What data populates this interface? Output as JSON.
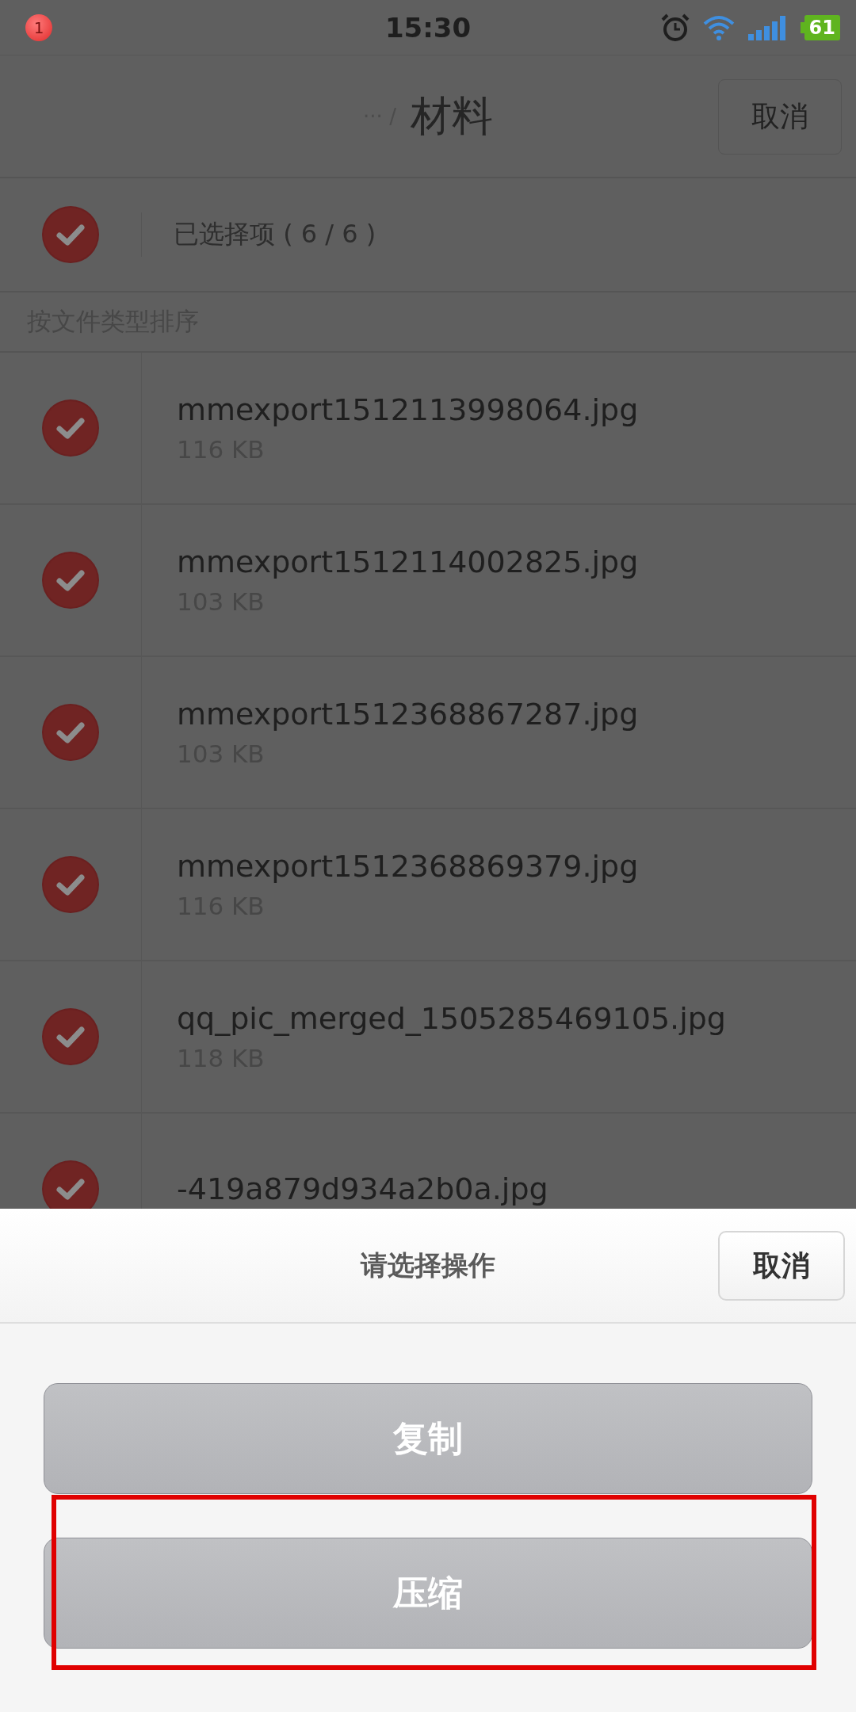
{
  "status_bar": {
    "notification_count": "1",
    "time": "15:30",
    "battery": "61"
  },
  "header": {
    "breadcrumb": "··· /",
    "title": "材料",
    "cancel": "取消"
  },
  "select_all": {
    "checked": true,
    "label": "已选择项 ( 6 / 6 )"
  },
  "sort_label": "按文件类型排序",
  "files": [
    {
      "name": "mmexport1512113998064.jpg",
      "size": "116 KB",
      "checked": true
    },
    {
      "name": "mmexport1512114002825.jpg",
      "size": "103 KB",
      "checked": true
    },
    {
      "name": "mmexport1512368867287.jpg",
      "size": "103 KB",
      "checked": true
    },
    {
      "name": "mmexport1512368869379.jpg",
      "size": "116 KB",
      "checked": true
    },
    {
      "name": "qq_pic_merged_1505285469105.jpg",
      "size": "118 KB",
      "checked": true
    },
    {
      "name": "-419a879d934a2b0a.jpg",
      "checked": true
    }
  ],
  "action_sheet": {
    "title": "请选择操作",
    "cancel": "取消",
    "actions": [
      {
        "label": "复制",
        "highlighted": false
      },
      {
        "label": "压缩",
        "highlighted": true
      }
    ]
  }
}
